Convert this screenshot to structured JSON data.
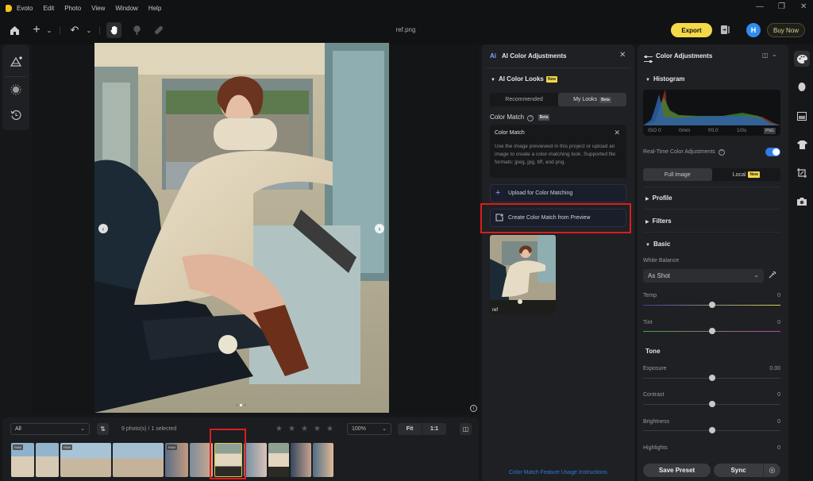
{
  "titlebar": {
    "app_name": "Evoto",
    "menu": [
      "Edit",
      "Photo",
      "View",
      "Window",
      "Help"
    ],
    "minimize_glyph": "—",
    "maximize_glyph": "❐",
    "close_glyph": "✕"
  },
  "toolbar": {
    "icons": [
      "home-icon",
      "add-icon",
      "chevron-down-icon",
      "undo-icon",
      "chevron-down-icon",
      "hand-icon",
      "brush-icon",
      "bandage-icon"
    ],
    "file_title": "ref.png",
    "export_label": "Export",
    "avatar_initial": "H",
    "buy_now_label": "Buy Now"
  },
  "left_tools": [
    "scene-icon",
    "blur-icon",
    "history-icon"
  ],
  "canvas": {
    "prev_glyph": "‹",
    "next_glyph": "›",
    "info_glyph": "i",
    "carousel_dots": 3,
    "active_dot": 2
  },
  "filmstrip": {
    "filter_value": "All",
    "sort_glyph": "⇅",
    "photo_count": "9 photo(s) / 1 selected",
    "rating_stars": 5,
    "rating_value": 0,
    "zoom_value": "100%",
    "fit_label": "Fit",
    "one_to_one_label": "1:1",
    "raw_badge": "RAW",
    "thumbnails": [
      {
        "raw": true,
        "selected": false
      },
      {
        "raw": false,
        "selected": false
      },
      {
        "raw": true,
        "selected": false
      },
      {
        "raw": false,
        "selected": false
      },
      {
        "raw": true,
        "selected": false
      },
      {
        "raw": false,
        "selected": false
      },
      {
        "raw": false,
        "selected": true
      },
      {
        "raw": false,
        "selected": false
      },
      {
        "raw": false,
        "selected": false
      },
      {
        "raw": false,
        "selected": false
      }
    ]
  },
  "ai_panel": {
    "title": "AI Color Adjustments",
    "logo_text": "Ai",
    "close_glyph": "✕",
    "looks_section": "AI Color Looks",
    "new_badge": "New",
    "beta_badge": "Beta",
    "tabs": [
      {
        "label": "Recommended",
        "active": false
      },
      {
        "label": "My Looks",
        "active": true
      }
    ],
    "color_match_label": "Color Match",
    "card_title": "Color Match",
    "card_description": "Use the image previewed in this project or upload an image to create a color-matching look. Supported file formats: jpeg, jpg, tiff, and png.",
    "upload_label": "Upload for Color Matching",
    "create_from_preview_label": "Create Color Match from Preview",
    "ref_label": "ref",
    "instructions_link": "Color Match Feature Usage Instructions"
  },
  "color_panel": {
    "title": "Color Adjustments",
    "histogram_label": "Histogram",
    "hist_meta": {
      "iso": "ISO 0",
      "focal": "0mm",
      "aperture": "f/0.0",
      "shutter": "1/0s",
      "format": "PNG"
    },
    "realtime_label": "Real-Time Color Adjustments",
    "realtime_enabled": true,
    "scope_tabs": [
      {
        "label": "Full Image",
        "active": true
      },
      {
        "label": "Local",
        "active": false,
        "badge": "New"
      }
    ],
    "profile_label": "Profile",
    "filters_label": "Filters",
    "basic_label": "Basic",
    "white_balance_label": "White Balance",
    "white_balance_value": "As Shot",
    "tone_label": "Tone",
    "sliders": [
      {
        "label": "Temp",
        "value": "0",
        "position": 0.5
      },
      {
        "label": "Tint",
        "value": "0",
        "position": 0.5
      },
      {
        "label": "Exposure",
        "value": "0.00",
        "position": 0.5
      },
      {
        "label": "Contrast",
        "value": "0",
        "position": 0.5
      },
      {
        "label": "Brightness",
        "value": "0",
        "position": 0.5
      },
      {
        "label": "Highlights",
        "value": "0",
        "position": 0.5
      }
    ],
    "save_preset_label": "Save Preset",
    "sync_label": "Sync"
  },
  "right_rail": [
    "palette-icon",
    "face-icon",
    "background-icon",
    "clothing-icon",
    "crop-icon",
    "camera-icon"
  ],
  "colors": {
    "accent_yellow": "#f5d949",
    "accent_blue": "#2f7ae8",
    "highlight_red": "#d81e1e",
    "link_blue": "#2f7ad8"
  }
}
